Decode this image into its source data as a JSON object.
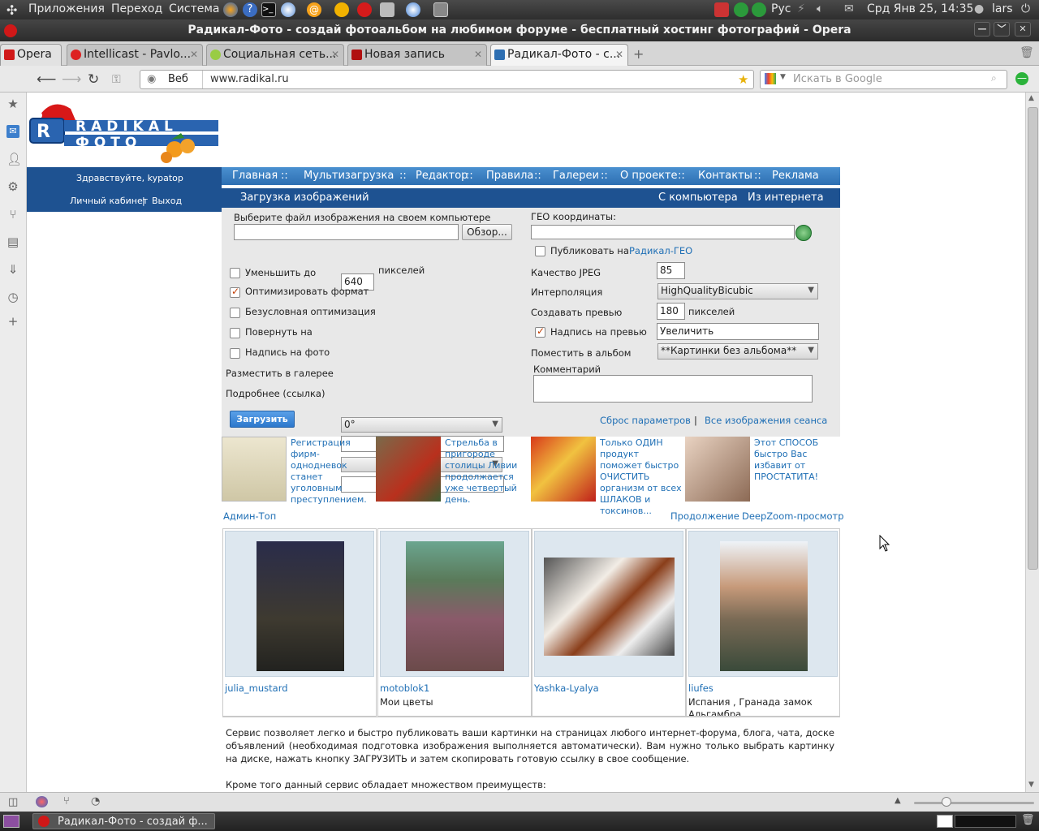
{
  "panel": {
    "menu_apps": "Приложения",
    "menu_go": "Переход",
    "menu_system": "Система",
    "lang": "Рус",
    "clock": "Срд Янв 25, 14:35",
    "user": "lars"
  },
  "window": {
    "title": "Радикал-Фото - создай фотоальбом на любимом форуме - бесплатный хостинг фотографий - Opera"
  },
  "tabs": [
    {
      "label": "Opera"
    },
    {
      "label": "Intellicast - Pavlo..."
    },
    {
      "label": "Социальная сеть..."
    },
    {
      "label": "Новая запись"
    },
    {
      "label": "Радикал-Фото - с..."
    }
  ],
  "addressbar": {
    "scope": "Веб",
    "url": "www.radikal.ru",
    "search_placeholder": "Искать в Google"
  },
  "site": {
    "logo_text": "RADIKAL ФОТО",
    "greeting": "Здравствуйте, kypatop",
    "cabinet": "Личный кабинет",
    "sep_bar": "|",
    "logout": "Выход",
    "nav": [
      "Главная",
      "Мультизагрузка",
      "Редактор",
      "Правила",
      "Галереи",
      "О проекте",
      "Контакты",
      "Реклама"
    ],
    "nav_sep": "::",
    "upload_title": "Загрузка изображений",
    "from_computer": "С компьютера",
    "from_internet": "Из интернета",
    "form": {
      "choose_file": "Выберите файл изображения на своем компьютере",
      "browse": "Обзор...",
      "geo": "ГЕО координаты:",
      "publish_on": "Публиковать на",
      "radikal_geo": "Радикал-ГЕО",
      "reduce_to": "Уменьшить до",
      "reduce_value": "640",
      "pixels": "пикселей",
      "optimize_format": "Оптимизировать формат",
      "unconditional_opt": "Безусловная оптимизация",
      "rotate": "Повернуть на",
      "rotate_value": "0°",
      "caption_photo": "Надпись на фото",
      "place_gallery": "Разместить в галерее",
      "more_link": "Подробнее (ссылка)",
      "jpeg_quality": "Качество JPEG",
      "jpeg_value": "85",
      "interpolation": "Интерполяция",
      "interp_value": "HighQualityBicubic",
      "create_preview": "Создавать превью",
      "preview_value": "180",
      "preview_caption": "Надпись на превью",
      "preview_caption_value": "Увеличить",
      "album": "Поместить в альбом",
      "album_value": "**Картинки без альбома**",
      "comment": "Комментарий",
      "upload": "Загрузить",
      "reset": "Сброс параметров",
      "all_session": "Все изображения сеанса"
    },
    "ads": [
      "Регистрация фирм-однодневок станет уголовным преступлением.",
      "Стрельба в пригороде столицы Ливии продолжается уже четвертый день.",
      "Только ОДИН продукт поможет быстро ОЧИСТИТЬ организм от всех ШЛАКОВ и токсинов...",
      "Этот СПОСОБ быстро Вас избавит от ПРОСТАТИТА!"
    ],
    "admin_top": "Админ-Топ",
    "continue": "Продолжение",
    "deepzoom": "DeepZoom-просмотр",
    "gallery": [
      {
        "user": "julia_mustard",
        "caption": ""
      },
      {
        "user": "motoblok1",
        "caption": "Мои цветы"
      },
      {
        "user": "Yashka-Lyalya",
        "caption": ""
      },
      {
        "user": "liufes",
        "caption": "Испания , Гранада замок Альгамбра"
      }
    ],
    "description": "Сервис позволяет легко и быстро публиковать ваши картинки на страницах любого интернет-форума, блога, чата, доске объявлений (необходимая подготовка изображения выполняется автоматически). Вам нужно только выбрать картинку на диске, нажать кнопку ЗАГРУЗИТЬ и затем скопировать готовую ссылку в свое сообщение.",
    "advantages": "Кроме того данный сервис обладает множеством преимуществ:"
  },
  "taskbar": {
    "task": "Радикал-Фото - создай ф..."
  },
  "colors": {
    "nav_blue": "#2e6fb2",
    "dark_blue": "#1e5291",
    "link": "#1f6fb5"
  }
}
